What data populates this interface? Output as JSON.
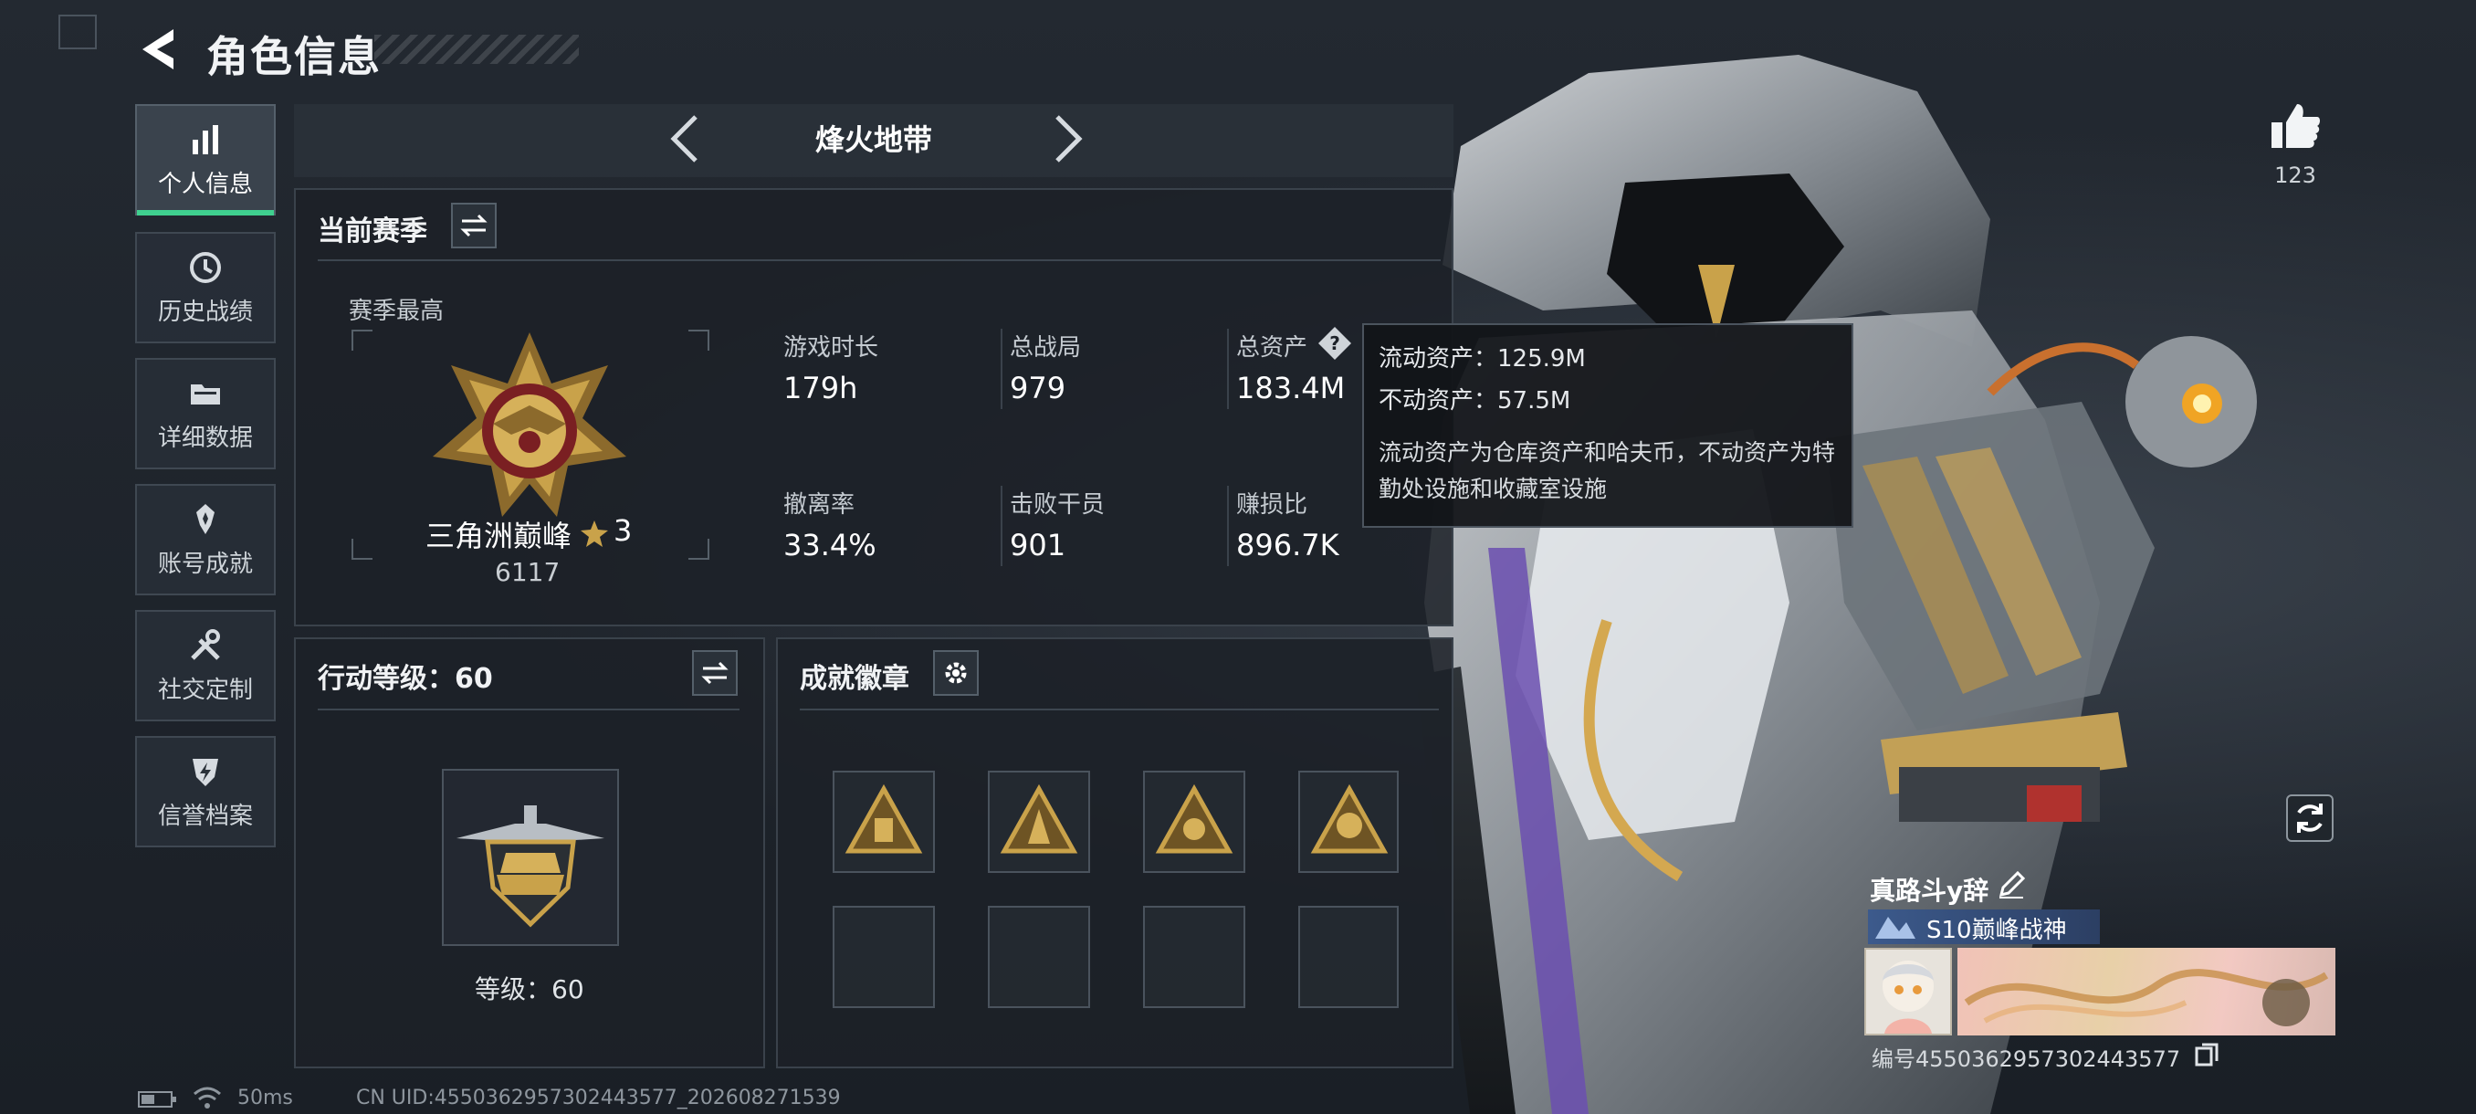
{
  "header": {
    "title": "角色信息"
  },
  "sidebar": {
    "items": [
      {
        "label": "个人信息",
        "active": true,
        "icon": "bar-chart-icon"
      },
      {
        "label": "历史战绩",
        "active": false,
        "icon": "history-clock-icon"
      },
      {
        "label": "详细数据",
        "active": false,
        "icon": "folder-icon"
      },
      {
        "label": "账号成就",
        "active": false,
        "icon": "achievement-star-icon"
      },
      {
        "label": "社交定制",
        "active": false,
        "icon": "tools-icon"
      },
      {
        "label": "信誉档案",
        "active": false,
        "icon": "shield-lightning-icon"
      }
    ]
  },
  "mode": {
    "title": "烽火地带"
  },
  "season": {
    "title": "当前赛季",
    "subtitle": "赛季最高",
    "rank_name": "三角洲巅峰",
    "rank_stars": "3",
    "rank_score": "6117",
    "stats": [
      {
        "label": "游戏时长",
        "value": "179h"
      },
      {
        "label": "总战局",
        "value": "979"
      },
      {
        "label": "总资产",
        "value": "183.4M"
      },
      {
        "label": "撤离率",
        "value": "33.4%"
      },
      {
        "label": "击败干员",
        "value": "901"
      },
      {
        "label": "赚损比",
        "value": "896.7K"
      }
    ]
  },
  "tooltip": {
    "liquid": "流动资产：125.9M",
    "fixed": "不动资产：57.5M",
    "description": "流动资产为仓库资产和哈夫币，不动资产为特勤处设施和收藏室设施"
  },
  "action_level": {
    "title": "行动等级：60",
    "level_text": "等级：60"
  },
  "achievements": {
    "title": "成就徽章"
  },
  "likes": {
    "count": "123"
  },
  "player": {
    "name": "真路斗y辞",
    "title_badge": "S10巅峰战神",
    "id_text": "编号4550362957302443577"
  },
  "footer": {
    "ping": "50ms",
    "uid": "CN UID:4550362957302443577_202608271539"
  },
  "colors": {
    "accent": "#3fd08f",
    "panel_bg": "#1c2128",
    "gold": "#c9a24a"
  }
}
